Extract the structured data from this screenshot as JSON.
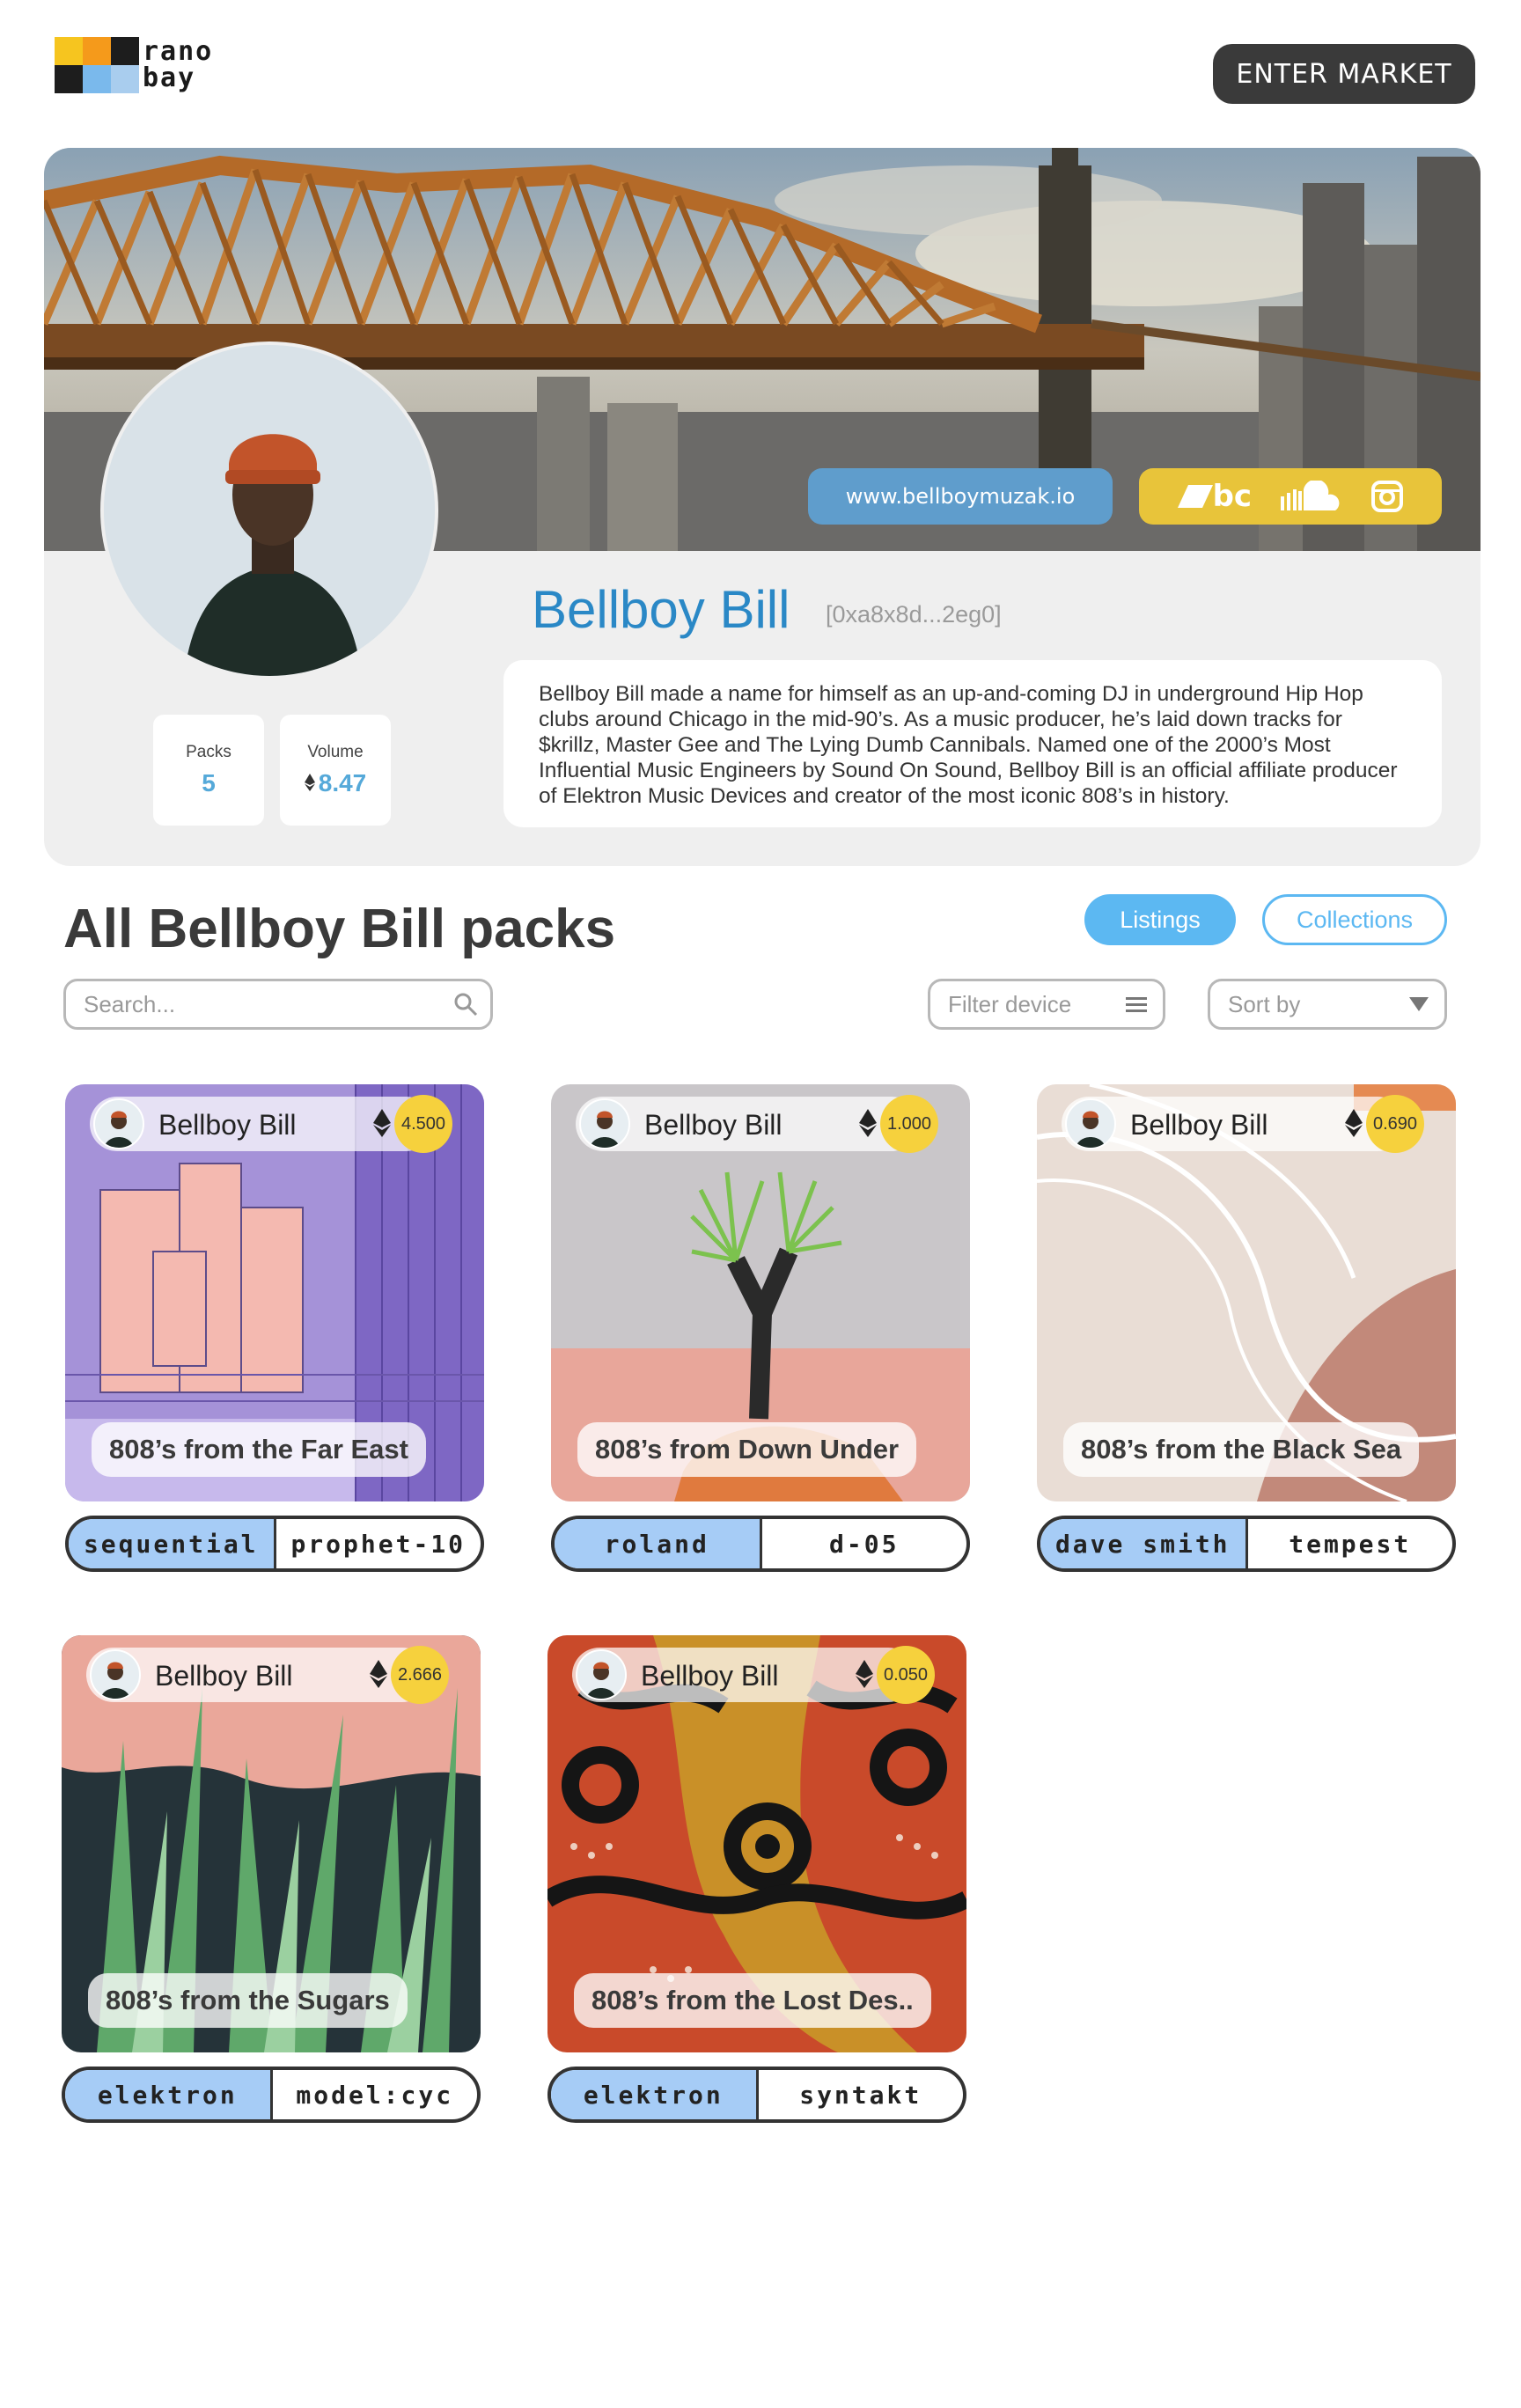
{
  "brand": {
    "logo_text_top": "rano",
    "logo_text_bottom": "bay"
  },
  "header": {
    "enter_market_label": "ENTER MARKET"
  },
  "profile": {
    "name": "Bellboy Bill",
    "wallet": "[0xa8x8d...2eg0]",
    "website": "www.bellboymuzak.io",
    "socials": [
      "bandcamp-icon",
      "soundcloud-icon",
      "instagram-icon"
    ],
    "bandcamp_text": "bc",
    "bio": "Bellboy Bill made a name for himself as an up-and-coming DJ in underground Hip Hop clubs around Chicago in the mid-90’s. As a music producer, he’s laid down tracks for $krillz, Master Gee and The Lying Dumb Cannibals. Named one of the 2000’s Most Influential Music Engineers by Sound On Sound, Bellboy Bill is an official affiliate producer of Elektron Music Devices and creator of the most iconic 808’s in history.",
    "stats": {
      "packs_label": "Packs",
      "packs_value": "5",
      "volume_label": "Volume",
      "volume_value": "8.47"
    }
  },
  "section": {
    "title": "All Bellboy Bill packs",
    "tab_listings": "Listings",
    "tab_collections": "Collections",
    "search_placeholder": "Search...",
    "filter_device": "Filter device",
    "sort_by": "Sort by"
  },
  "packs": [
    {
      "artist": "Bellboy Bill",
      "price": "4.500",
      "title": "808’s from the Far East",
      "tag_a": "sequential",
      "tag_b": "prophet-10"
    },
    {
      "artist": "Bellboy Bill",
      "price": "1.000",
      "title": "808’s from Down Under",
      "tag_a": "roland",
      "tag_b": "d-05"
    },
    {
      "artist": "Bellboy Bill",
      "price": "0.690",
      "title": "808’s from the Black Sea",
      "tag_a": "dave smith",
      "tag_b": "tempest"
    },
    {
      "artist": "Bellboy Bill",
      "price": "2.666",
      "title": "808’s from the Sugars",
      "tag_a": "elektron",
      "tag_b": "model:cyc"
    },
    {
      "artist": "Bellboy Bill",
      "price": "0.050",
      "title": "808’s from the Lost Des..",
      "tag_a": "elektron",
      "tag_b": "syntakt"
    }
  ],
  "colors": {
    "accent_blue": "#2a88c6",
    "tab_blue": "#5cb8f2",
    "price_yellow": "#f6d13d",
    "social_yellow": "#e8c43a",
    "tag_blue": "#a6ccf6"
  }
}
